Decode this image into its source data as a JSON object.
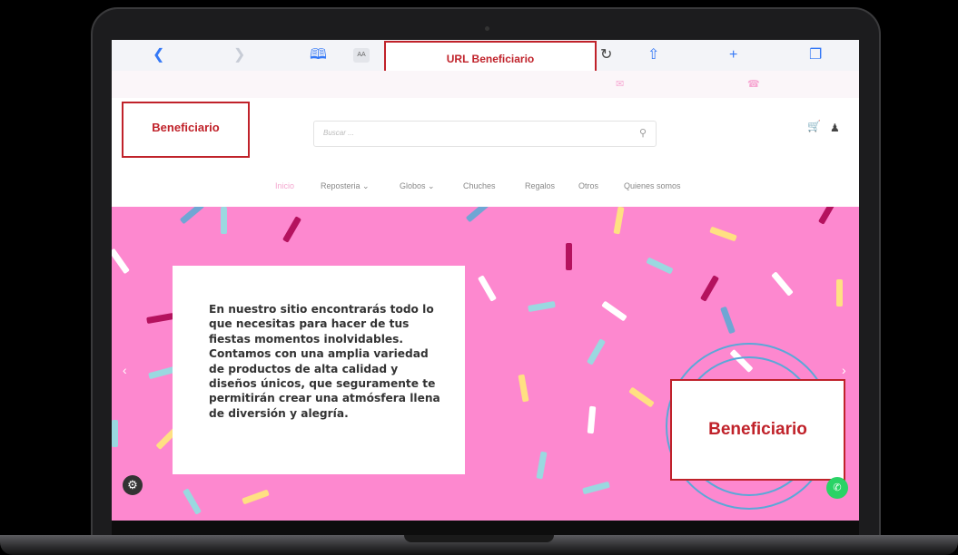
{
  "browser": {
    "url_label": "URL Beneficiario",
    "reader_label": "AA"
  },
  "header": {
    "logo_label": "Beneficiario",
    "search_placeholder": "Buscar ..."
  },
  "nav": {
    "items": [
      "Inicio",
      "Reposteria",
      "Globos",
      "Chuches",
      "Regalos",
      "Otros",
      "Quienes somos"
    ]
  },
  "hero": {
    "text": "En nuestro sitio encontrarás todo lo que necesitas para hacer de tus fiestas momentos inolvidables. Contamos con una amplia variedad de productos de alta calidad y diseños únicos, que seguramente te permitirán crear una atmósfera llena de diversión y alegría.",
    "beneficiary_label": "Beneficiario"
  },
  "colors": {
    "accent": "#c0222a",
    "hero_bg": "#fd88cf",
    "link_blue": "#3478f6",
    "whatsapp": "#2ad366"
  },
  "icons": [
    "back-icon",
    "forward-icon",
    "bookmarks-icon",
    "reload-icon",
    "share-icon",
    "plus-icon",
    "tabs-icon",
    "search-icon",
    "cart-icon",
    "user-icon",
    "gear-icon",
    "whatsapp-icon"
  ]
}
